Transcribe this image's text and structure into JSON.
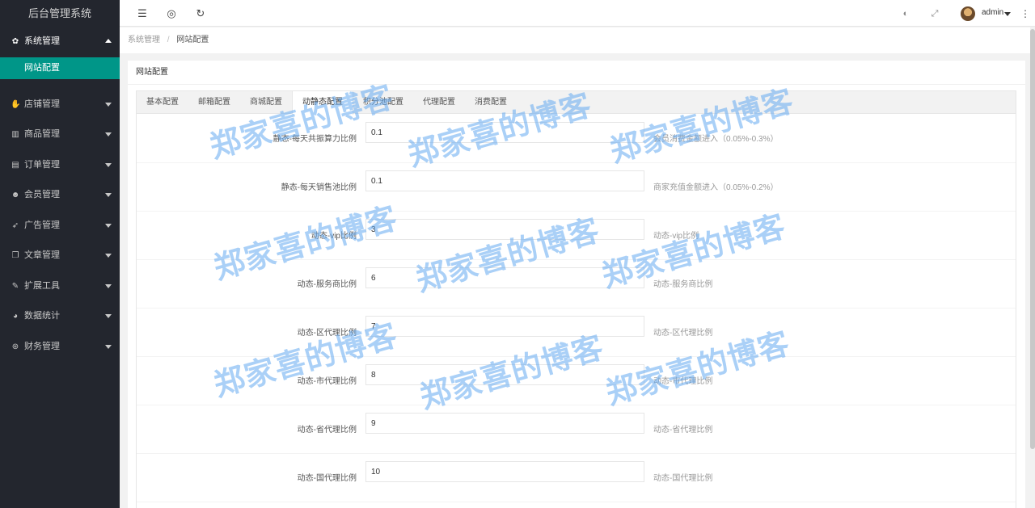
{
  "app": {
    "title": "后台管理系统"
  },
  "sidebar": {
    "items": [
      {
        "label": "系统管理",
        "icon": "gear-icon",
        "glyph": "✿",
        "open": true,
        "children": [
          {
            "label": "网站配置",
            "active": true
          }
        ]
      },
      {
        "label": "店铺管理",
        "icon": "hand-icon",
        "glyph": "✋"
      },
      {
        "label": "商品管理",
        "icon": "bar-chart-icon",
        "glyph": "▥"
      },
      {
        "label": "订单管理",
        "icon": "calendar-icon",
        "glyph": "▤"
      },
      {
        "label": "会员管理",
        "icon": "users-icon",
        "glyph": "☻"
      },
      {
        "label": "广告管理",
        "icon": "rocket-icon",
        "glyph": "➶"
      },
      {
        "label": "文章管理",
        "icon": "copy-icon",
        "glyph": "❐"
      },
      {
        "label": "扩展工具",
        "icon": "wrench-icon",
        "glyph": "✎"
      },
      {
        "label": "数据统计",
        "icon": "pie-chart-icon",
        "glyph": "◕"
      },
      {
        "label": "财务管理",
        "icon": "money-icon",
        "glyph": "⊛"
      }
    ]
  },
  "header": {
    "user": "admin"
  },
  "breadcrumb": {
    "parent": "系统管理",
    "separator": "/",
    "current": "网站配置"
  },
  "card": {
    "title": "网站配置"
  },
  "tabs": [
    {
      "label": "基本配置"
    },
    {
      "label": "邮箱配置"
    },
    {
      "label": "商城配置"
    },
    {
      "label": "动静态配置",
      "active": true
    },
    {
      "label": "积分池配置"
    },
    {
      "label": "代理配置"
    },
    {
      "label": "消费配置"
    }
  ],
  "form": {
    "rows": [
      {
        "label": "静态-每天共振算力比例",
        "value": "0.1",
        "hint": "会员消费金额进入（0.05%-0.3%）"
      },
      {
        "label": "静态-每天销售池比例",
        "value": "0.1",
        "hint": "商家充值金额进入（0.05%-0.2%）"
      },
      {
        "label": "动态-vip比例",
        "value": "3",
        "hint": "动态-vip比例"
      },
      {
        "label": "动态-服务商比例",
        "value": "6",
        "hint": "动态-服务商比例"
      },
      {
        "label": "动态-区代理比例",
        "value": "7",
        "hint": "动态-区代理比例"
      },
      {
        "label": "动态-市代理比例",
        "value": "8",
        "hint": "动态-市代理比例"
      },
      {
        "label": "动态-省代理比例",
        "value": "9",
        "hint": "动态-省代理比例"
      },
      {
        "label": "动态-国代理比例",
        "value": "10",
        "hint": "动态-国代理比例"
      }
    ]
  },
  "watermark": {
    "text": "郑家喜的博客"
  },
  "colors": {
    "sidebar": "#23262e",
    "accent": "#009688",
    "watermark": "#64aaf0"
  }
}
